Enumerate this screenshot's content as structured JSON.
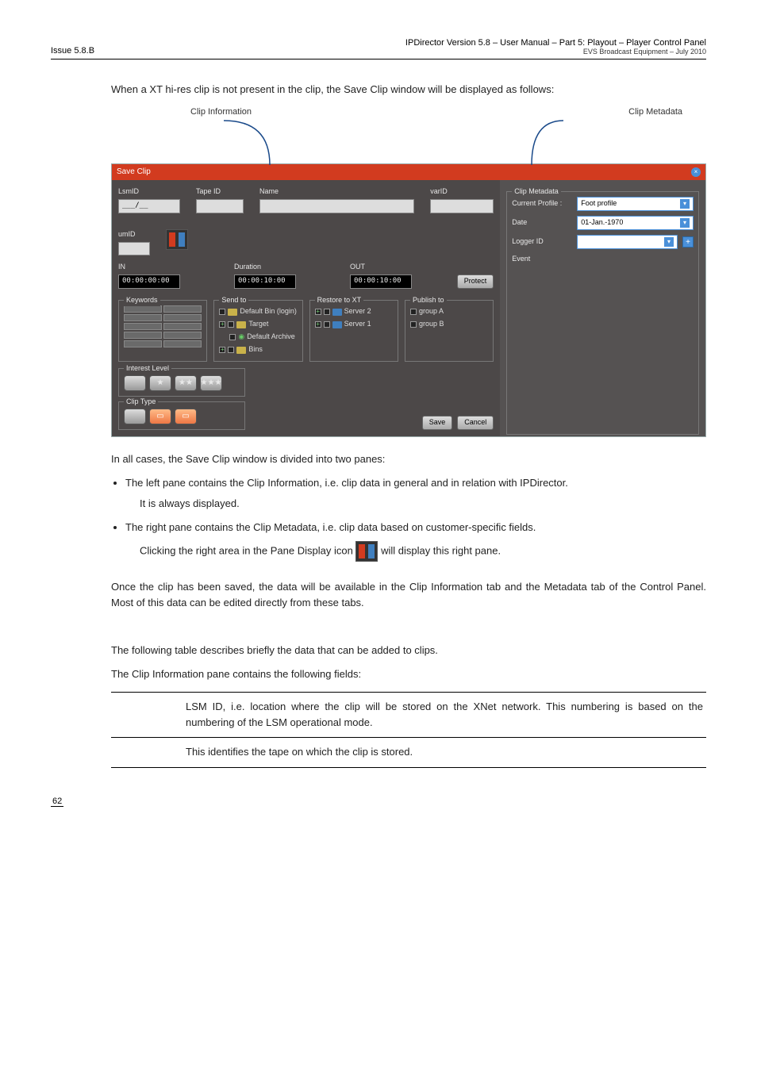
{
  "header": {
    "issue": "Issue 5.8.B",
    "title": "IPDirector Version 5.8 – User Manual – Part 5: Playout – Player Control Panel",
    "sub": "EVS Broadcast Equipment – July 2010"
  },
  "intro": "When a XT hi-res clip is not present in the clip, the Save Clip window will be displayed as follows:",
  "callouts": {
    "left": "Clip Information",
    "right": "Clip Metadata"
  },
  "ss": {
    "title": "Save Clip",
    "lsmid_label": "LsmID",
    "lsmid_val": "___/__",
    "tapeid_label": "Tape ID",
    "name_label": "Name",
    "varid_label": "varID",
    "umid_label": "umID",
    "in_label": "IN",
    "in_val": "00:00:00:00",
    "duration_label": "Duration",
    "duration_val": "00:00:10:00",
    "out_label": "OUT",
    "out_val": "00:00:10:00",
    "protect": "Protect",
    "keywords_label": "Keywords",
    "sendto_label": "Send to",
    "sendto_items": [
      "Default Bin (login)",
      "Target",
      "Default Archive",
      "Bins"
    ],
    "restore_label": "Restore to XT",
    "restore_items": [
      "Server 2",
      "Server 1"
    ],
    "publish_label": "Publish to",
    "publish_items": [
      "group A",
      "group B"
    ],
    "interest_label": "Interest Level",
    "cliptype_label": "Clip Type",
    "save": "Save",
    "cancel": "Cancel",
    "meta_label": "Clip Metadata",
    "profile_label": "Current Profile :",
    "profile_val": "Foot profile",
    "date_label": "Date",
    "date_val": "01-Jan.-1970",
    "logger_label": "Logger ID",
    "event_label": "Event"
  },
  "body": {
    "p1": "In all cases, the Save Clip window is divided into two panes:",
    "li1": "The left pane contains the Clip Information, i.e. clip data in general and in relation with IPDirector.",
    "li1b": "It is always displayed.",
    "li2": "The right pane contains the Clip Metadata, i.e. clip data based on customer-specific fields.",
    "li2b_pre": "Clicking the right area in the Pane Display icon ",
    "li2b_post": " will display this right pane.",
    "p2": "Once the clip has been saved, the data will be available in the Clip Information tab and the Metadata tab of the Control Panel. Most of this data can be edited directly from these tabs.",
    "p3": "The following table describes briefly the data that can be added to clips.",
    "p4": "The Clip Information pane contains the following fields:"
  },
  "table": {
    "r1": "LSM ID, i.e. location where the clip will be stored on the XNet network. This numbering is based on the numbering of the LSM operational mode.",
    "r2": "This identifies the tape on which the clip is stored."
  },
  "footer": {
    "page": "62"
  }
}
